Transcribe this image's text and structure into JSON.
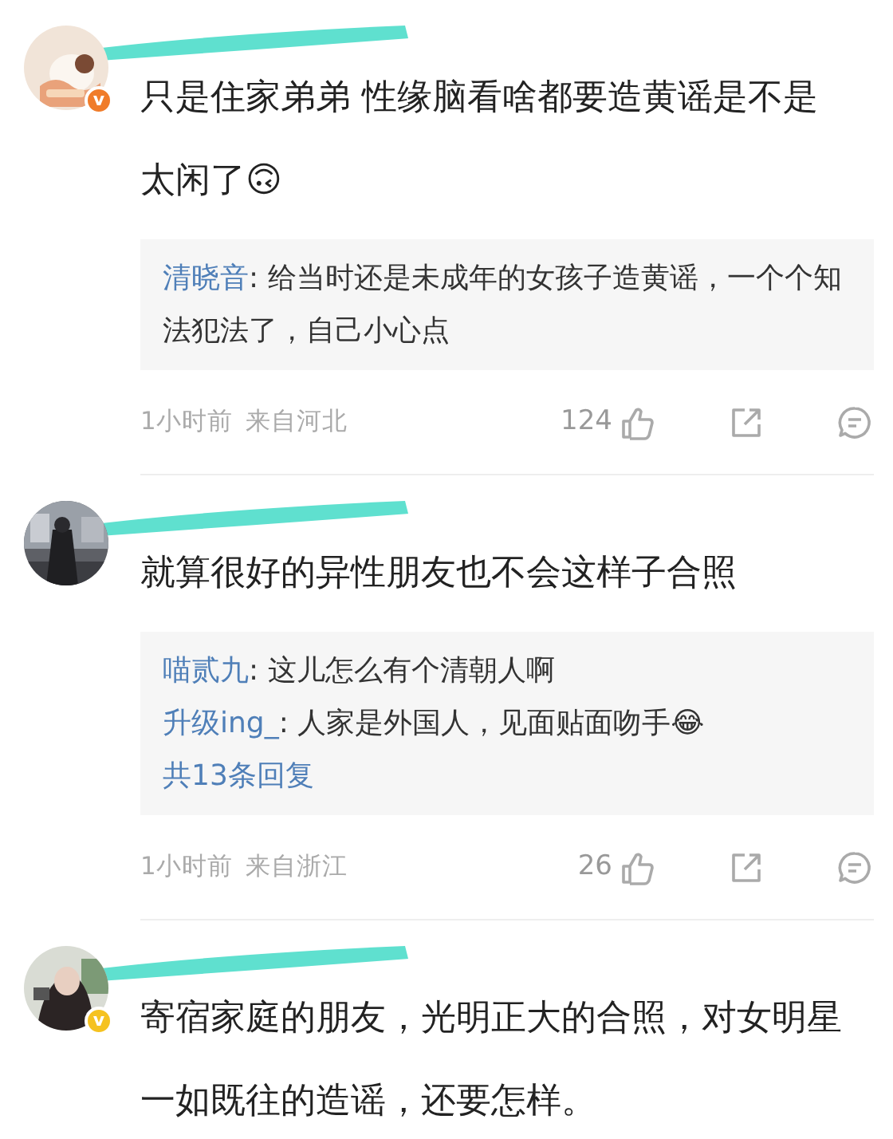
{
  "comments": [
    {
      "avatar": {
        "kind": "picture"
      },
      "badge": {
        "letter": "v",
        "color": "#f07c2a"
      },
      "text": "只是住家弟弟 性缘脑看啥都要造黄谣是不是太闲了🙃",
      "replies": [
        {
          "author": "清晓音",
          "text": ": 给当时还是未成年的女孩子造黄谣，一个个知法犯法了，自己小心点"
        }
      ],
      "time": "1小时前",
      "location": "来自河北",
      "likes": "124"
    },
    {
      "avatar": {
        "kind": "picture"
      },
      "text": "就算很好的异性朋友也不会这样子合照",
      "replies": [
        {
          "author": "喵贰九",
          "text": ": 这儿怎么有个清朝人啊"
        },
        {
          "author": "升级ing_",
          "text": ": 人家是外国人，见面贴面吻手😂"
        }
      ],
      "more": "共13条回复",
      "time": "1小时前",
      "location": "来自浙江",
      "likes": "26"
    },
    {
      "avatar": {
        "kind": "picture"
      },
      "badge": {
        "letter": "v",
        "color": "#f5c220"
      },
      "text": "寄宿家庭的朋友，光明正大的合照，对女明星一如既往的造谣，还要怎样。"
    }
  ]
}
